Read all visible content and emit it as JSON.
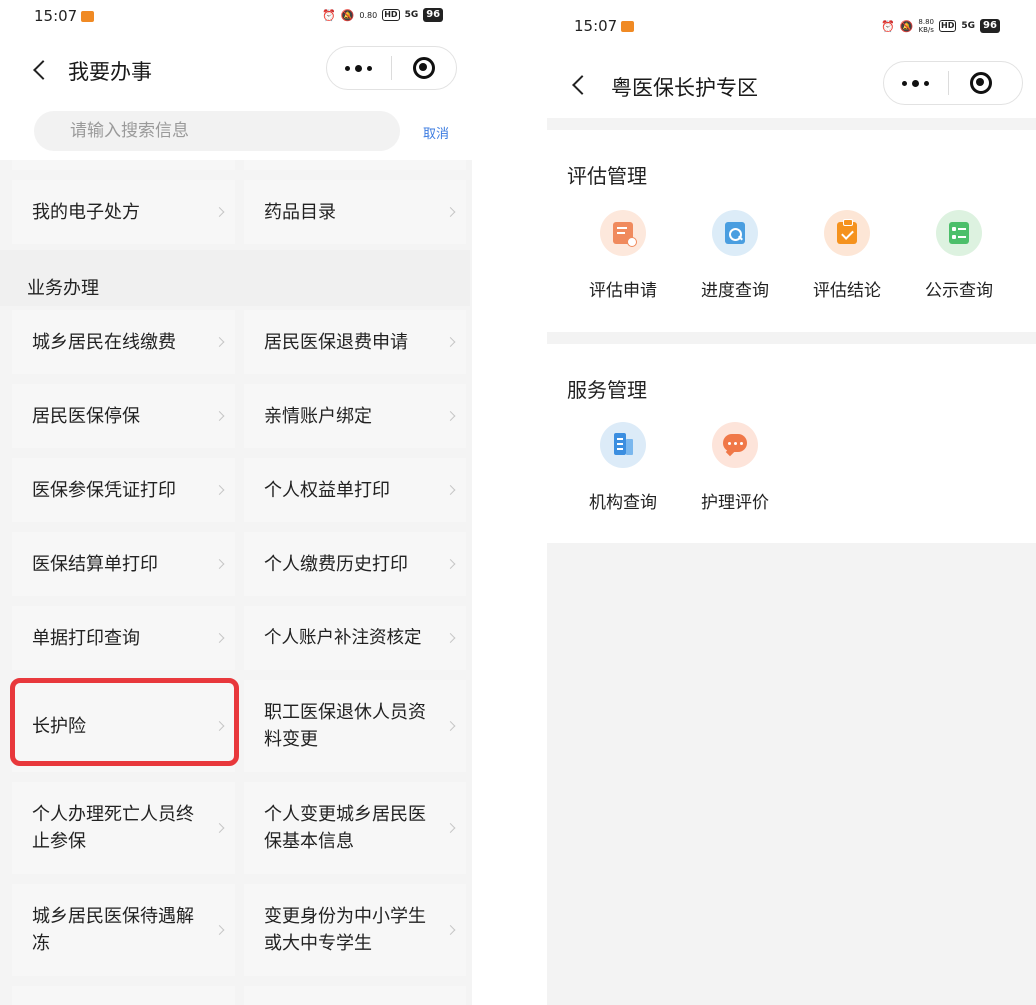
{
  "left": {
    "status": {
      "time": "15:07",
      "network": "5G",
      "speed": "0.80",
      "battery": "96"
    },
    "nav": {
      "title": "我要办事"
    },
    "search": {
      "placeholder": "请输入搜索信息",
      "cancel": "取消"
    },
    "top_items": [
      "我的电子处方",
      "药品目录"
    ],
    "section": "业务办理",
    "items": [
      [
        "城乡居民在线缴费",
        "居民医保退费申请"
      ],
      [
        "居民医保停保",
        "亲情账户绑定"
      ],
      [
        "医保参保凭证打印",
        "个人权益单打印"
      ],
      [
        "医保结算单打印",
        "个人缴费历史打印"
      ],
      [
        "单据打印查询",
        "个人账户补注资核定"
      ],
      [
        "长护险",
        "职工医保退休人员资料变更"
      ],
      [
        "个人办理死亡人员终止参保",
        "个人变更城乡居民医保基本信息"
      ],
      [
        "城乡居民医保待遇解冻",
        "变更身份为中小学生或大中专学生"
      ]
    ],
    "highlight_color": "#e8383c"
  },
  "right": {
    "status": {
      "time": "15:07",
      "network": "5G",
      "speed": "8.80",
      "speed_unit": "KB/s",
      "battery": "96"
    },
    "nav": {
      "title": "粤医保长护专区"
    },
    "sections": [
      {
        "title": "评估管理",
        "items": [
          {
            "label": "评估申请",
            "icon": "application-form-icon",
            "bg": "#fde8dc",
            "fg": "#f08a5d"
          },
          {
            "label": "进度查询",
            "icon": "search-document-icon",
            "bg": "#dcecf8",
            "fg": "#4a9ee0"
          },
          {
            "label": "评估结论",
            "icon": "clipboard-check-icon",
            "bg": "#fde6d6",
            "fg": "#f5921e"
          },
          {
            "label": "公示查询",
            "icon": "checklist-icon",
            "bg": "#ddf2e0",
            "fg": "#4cbf6a"
          }
        ]
      },
      {
        "title": "服务管理",
        "items": [
          {
            "label": "机构查询",
            "icon": "building-icon",
            "bg": "#dcebf8",
            "fg": "#3b8ee0"
          },
          {
            "label": "护理评价",
            "icon": "chat-bubble-icon",
            "bg": "#fde4da",
            "fg": "#f07848"
          }
        ]
      }
    ]
  }
}
